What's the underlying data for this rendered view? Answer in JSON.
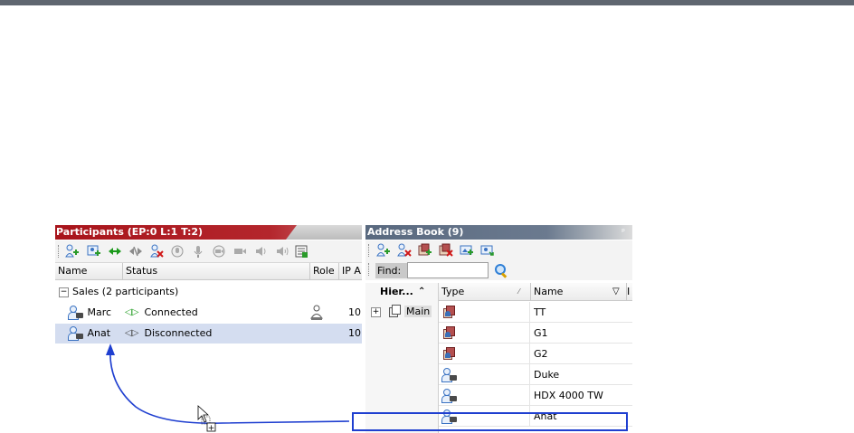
{
  "participants_panel": {
    "title": "Participants (EP:0 L:1 T:2)",
    "toolbar_icons": [
      "add-participant-icon",
      "add-from-address-book-icon",
      "connect-icon",
      "disconnect-icon",
      "delete-participant-icon",
      "mute-audio-icon",
      "microphone-icon",
      "suspend-video-icon",
      "camera-icon",
      "volume-icon",
      "volume-low-icon",
      "participant-properties-icon"
    ],
    "columns": [
      "Name",
      "Status",
      "Role",
      "IP A"
    ],
    "group": {
      "expander": "−",
      "label": "Sales (2 participants)"
    },
    "rows": [
      {
        "name": "Marc",
        "status_glyph": "◁▷",
        "status": "Connected",
        "status_color": "#1b9a1b",
        "has_role_icon": true,
        "ip": "10"
      },
      {
        "name": "Anat",
        "status_glyph": "◁▷",
        "status": "Disconnected",
        "status_color": "#444444",
        "has_role_icon": false,
        "ip": "10",
        "selected": true
      }
    ]
  },
  "address_book": {
    "title": "Address Book (9)",
    "pin": "ᵖ",
    "toolbar_icons": [
      "add-participant-icon",
      "delete-participant-icon",
      "add-group-icon",
      "delete-group-icon",
      "add-meeting-room-icon",
      "import-icon"
    ],
    "find_label": "Find:",
    "find_value": "",
    "tree": {
      "header": "Hier...",
      "sort_glyph": "⌃",
      "expander": "+",
      "root": "Main"
    },
    "list_columns": [
      {
        "label": "Type",
        "mark": "⁄"
      },
      {
        "label": "Name",
        "mark": "▽"
      },
      {
        "label": "I",
        "mark": ""
      }
    ],
    "entries": [
      {
        "type": "room",
        "name": "TT"
      },
      {
        "type": "room",
        "name": "G1"
      },
      {
        "type": "room",
        "name": "G2"
      },
      {
        "type": "participant",
        "name": "Duke"
      },
      {
        "type": "participant",
        "name": "HDX 4000 TW"
      },
      {
        "type": "participant",
        "name": "Anat"
      }
    ]
  },
  "annotation": {
    "arrow_color": "#1f3fd0",
    "cursor_badge": "+"
  }
}
